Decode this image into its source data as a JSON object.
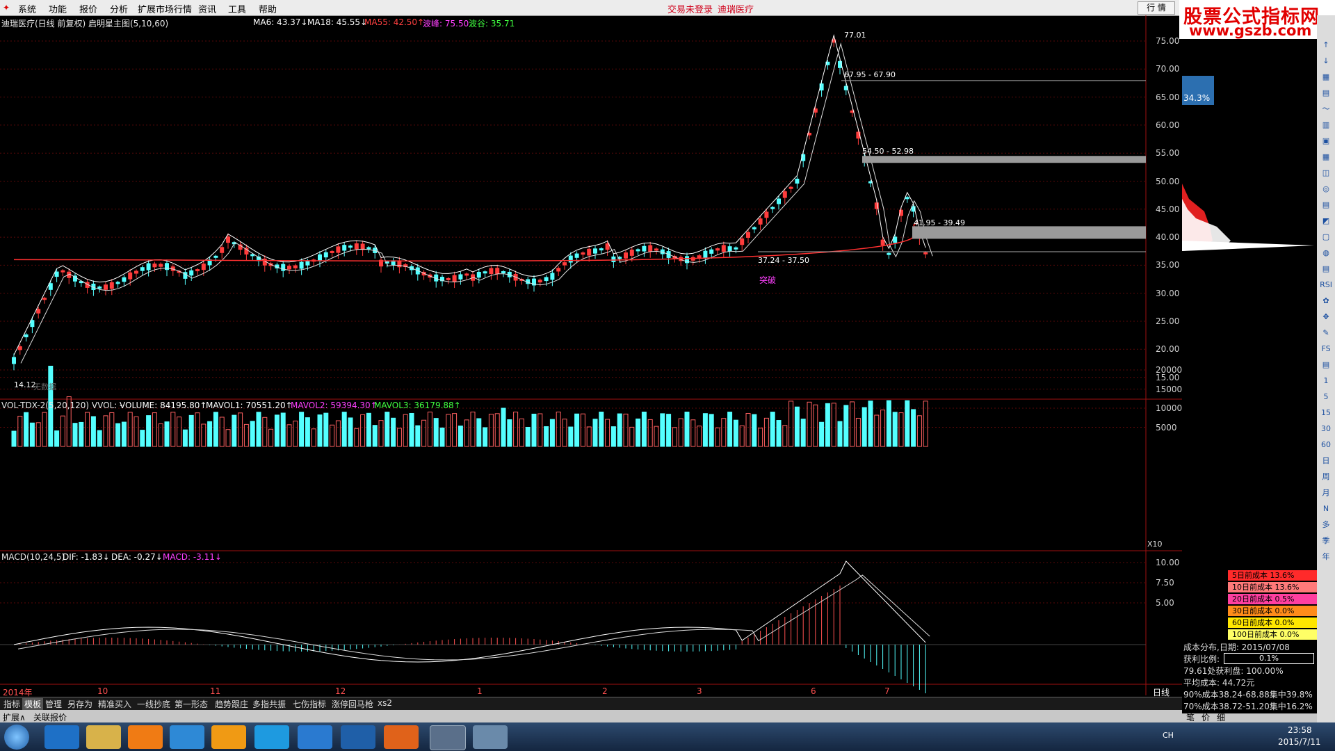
{
  "menubar": {
    "items": [
      "系统",
      "功能",
      "报价",
      "分析",
      "扩展市场行情",
      "资讯",
      "工具",
      "帮助"
    ],
    "login_status": "交易未登录",
    "stock_name": "迪瑞医疗",
    "hq_button": "行 情"
  },
  "watermark": {
    "line1": "股票公式指标网",
    "line2": "www.gszb.com"
  },
  "main_panel": {
    "title": "迪瑞医疗(日线 前复权) 启明星主图(5,10,60)",
    "ma6": "MA6: 43.37↓",
    "ma18": "MA18: 45.55↓",
    "ma55": "MA55: 42.50↑",
    "peak": "波峰: 75.50",
    "trough": "波谷: 35.71",
    "price_axis": [
      "75.00",
      "70.00",
      "65.00",
      "60.00",
      "55.00",
      "50.00",
      "45.00",
      "40.00",
      "35.00",
      "30.00",
      "25.00",
      "20.00",
      "15.00"
    ],
    "annotations": {
      "high": "77.01",
      "zone1": "67.95 - 67.90",
      "zone2": "54.50 - 52.98",
      "zone3": "41.95 - 39.49",
      "zone4": "37.24 - 37.50",
      "breakout": "突破",
      "low": "14.12",
      "nodata": "无数据"
    }
  },
  "vol_panel": {
    "title": "VOL-TDX-2(5,20,120) VVOL: -",
    "volume": "VOLUME: 84195.80↑",
    "mavol1": "MAVOL1: 70551.20↑",
    "mavol2": "MAVOL2: 59394.30↑",
    "mavol3": "MAVOL3: 36179.88↑",
    "axis": [
      "20000",
      "15000",
      "10000",
      "5000"
    ],
    "unit": "X10"
  },
  "macd_panel": {
    "title": "MACD(10,24,5)",
    "dif": "DIF: -1.83↓",
    "dea": "DEA: -0.27↓",
    "macd": "MACD: -3.11↓",
    "axis": [
      "10.00",
      "7.50",
      "5.00"
    ]
  },
  "time_axis": [
    "2014年",
    "10",
    "11",
    "12",
    "1",
    "2",
    "3",
    "6",
    "7"
  ],
  "period": "日线",
  "bottom_tabs": [
    "指标",
    "模板",
    "管理",
    "另存为",
    "精准买入",
    "一线抄底",
    "第一形态",
    "趋势跟庄",
    "多指共振",
    "七伤指标",
    "涨停回马枪",
    "xs2"
  ],
  "status_bar": [
    "扩展∧",
    "关联报价"
  ],
  "right_panel": {
    "pct_label": "34.3%",
    "cost_rows": [
      {
        "label": "5日前成本 13.6%",
        "color": "#ff2a2a"
      },
      {
        "label": "10日前成本 13.6%",
        "color": "#ff7a7a"
      },
      {
        "label": "20日前成本 0.5%",
        "color": "#ff3fa0"
      },
      {
        "label": "30日前成本 0.0%",
        "color": "#ff8c1a"
      },
      {
        "label": "60日前成本 0.0%",
        "color": "#ffe600"
      },
      {
        "label": "100日前成本 0.0%",
        "color": "#ffff66"
      }
    ],
    "cost_date": "成本分布,日期: 2015/07/08",
    "profit_label": "获利比例:",
    "profit_value": "0.1%",
    "profit_line": "79.61处获利盘: 100.00%",
    "avg_cost": "平均成本: 44.72元",
    "c90": "90%成本38.24-68.88集中39.8%",
    "c70": "70%成本38.72-51.20集中16.2%",
    "bottom_btns": [
      "笔",
      "价",
      "细"
    ]
  },
  "toolbar_right": [
    "↑",
    "↓",
    "▦",
    "▤",
    "〜",
    "▥",
    "▣",
    "▦",
    "◫",
    "◎",
    "▤",
    "◩",
    "▢",
    "◍",
    "▤",
    "RSI",
    "✿",
    "✥",
    "✎",
    "FS",
    "▤",
    "1",
    "5",
    "15",
    "30",
    "60",
    "日",
    "周",
    "月",
    "N",
    "多",
    "季",
    "年"
  ],
  "taskbar": {
    "time": "23:58",
    "date": "2015/7/11",
    "lang": "CH"
  },
  "colors": {
    "up": "#ff3c3c",
    "down": "#54ffff",
    "axis": "#a01010"
  }
}
